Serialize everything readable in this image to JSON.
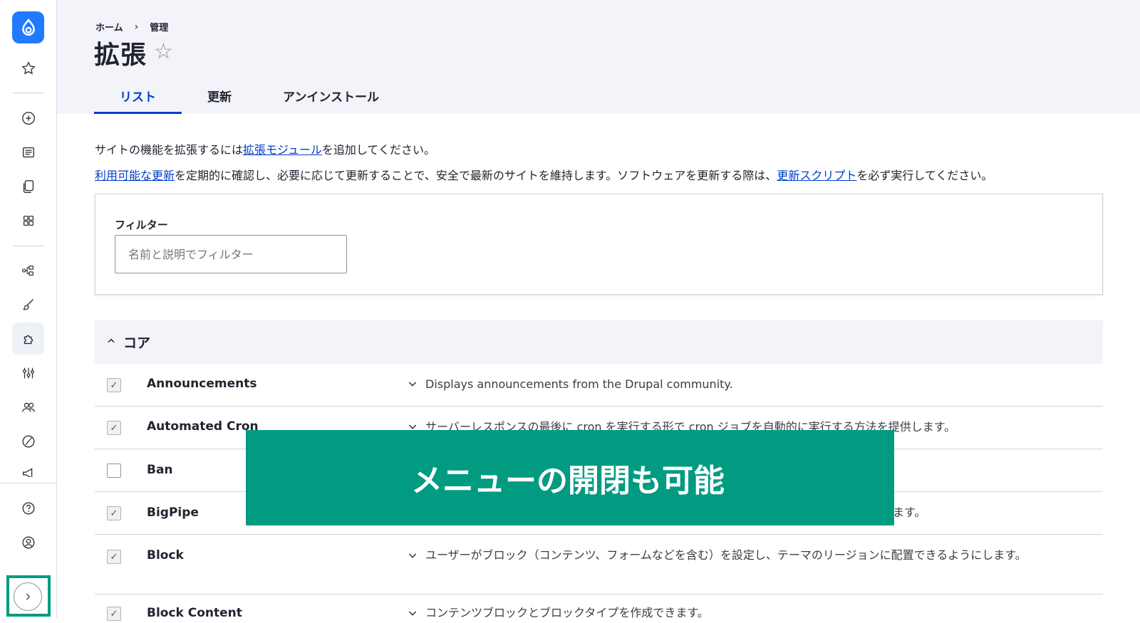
{
  "toolbar": {
    "icons": [
      "drupal-logo",
      "star-icon",
      "plus-circle-icon",
      "content-icon",
      "files-icon",
      "blocks-icon",
      "structure-icon",
      "appearance-icon",
      "extend-icon",
      "config-icon",
      "people-icon",
      "reports-icon",
      "announcements-icon",
      "help-icon",
      "user-icon",
      "chevron-right-icon"
    ],
    "accent": "#1f7aff"
  },
  "header": {
    "breadcrumb": [
      "ホーム",
      "管理"
    ],
    "breadcrumb_sep": "›",
    "title": "拡張",
    "star": "☆",
    "tabs": [
      "リスト",
      "更新",
      "アンインストール"
    ]
  },
  "intro": {
    "line1_pre": "サイトの機能を拡張するには",
    "line1_link": "拡張モジュール",
    "line1_post": "を追加してください。",
    "line2_link1": "利用可能な更新",
    "line2_mid": "を定期的に確認し、必要に応じて更新することで、安全で最新のサイトを維持します。ソフトウェアを更新する際は、",
    "line2_link2": "更新スクリプト",
    "line2_post": "を必ず実行してください。"
  },
  "filter": {
    "label": "フィルター",
    "placeholder": "名前と説明でフィルター"
  },
  "core": {
    "title": "コア",
    "modules": [
      {
        "name": "Announcements",
        "checked": true,
        "desc": "Displays announcements from the Drupal community."
      },
      {
        "name": "Automated Cron",
        "checked": true,
        "desc": "サーバーレスポンスの最後に cron を実行する形で cron ジョブを自動的に実行する方法を提供します。"
      },
      {
        "name": "Ban",
        "checked": false,
        "desc": ""
      },
      {
        "name": "BigPipe",
        "checked": true,
        "desc": "ます。"
      },
      {
        "name": "Block",
        "checked": true,
        "desc": "ユーザーがブロック（コンテンツ、フォームなどを含む）を設定し、テーマのリージョンに配置できるようにします。"
      },
      {
        "name": "Block Content",
        "checked": true,
        "desc": "コンテンツブロックとブロックタイプを作成できます。"
      }
    ]
  },
  "overlay": {
    "text": "メニューの開閉も可能",
    "color": "#009b81"
  },
  "colors": {
    "link": "#003ecc",
    "highlight": "#009b81"
  }
}
